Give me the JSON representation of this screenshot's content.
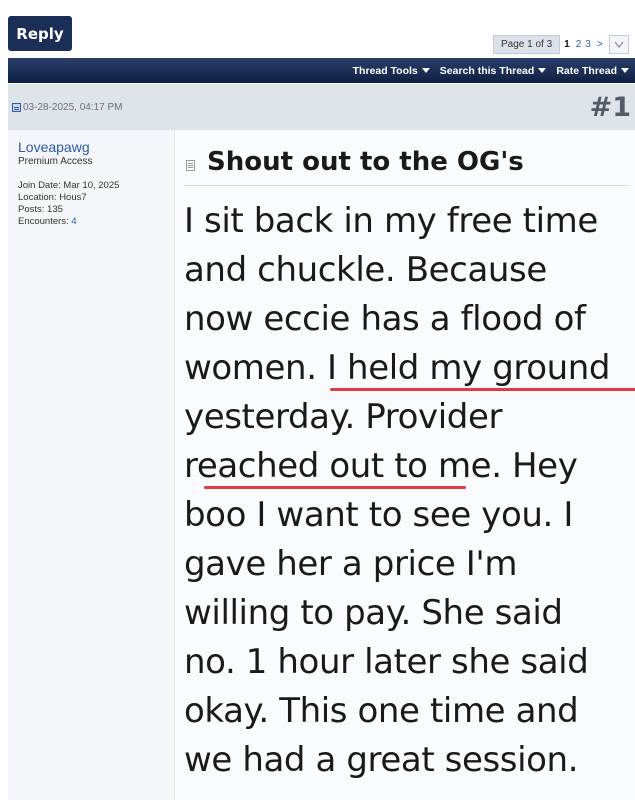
{
  "toolbar": {
    "reply_label": "Reply"
  },
  "pagination": {
    "summary": "Page 1 of 3",
    "pages": [
      "1",
      "2",
      "3"
    ],
    "next": ">"
  },
  "thread_menu": {
    "thread_tools": "Thread Tools",
    "search": "Search this Thread",
    "rate": "Rate Thread"
  },
  "post": {
    "date": "03-28-2025, 04:17 PM",
    "number": "#1",
    "title": "Shout out to the OG's",
    "body_lines": [
      "I sit back in my free time",
      "and chuckle. Because",
      "now eccie has a flood of",
      "women. I held my ground",
      "yesterday. Provider",
      "reached out to me. Hey",
      "boo I want to see you. I",
      "gave her a price I'm",
      "willing to pay. She said",
      "no. 1 hour later she said",
      "okay. This one time and",
      "we had a great session."
    ],
    "highlight_color": "#e53946"
  },
  "author": {
    "username": "Loveapawg",
    "title": "Premium Access",
    "join_date": "Join Date: Mar 10, 2025",
    "location": "Location: Hous7",
    "posts": "Posts: 135",
    "encounters_label": "Encounters:",
    "encounters_value": "4"
  },
  "colors": {
    "navbar": "#0f1f42",
    "reply_button": "#1b2e57",
    "link": "#2a5aa8",
    "header_bg": "#dfe3ea"
  }
}
